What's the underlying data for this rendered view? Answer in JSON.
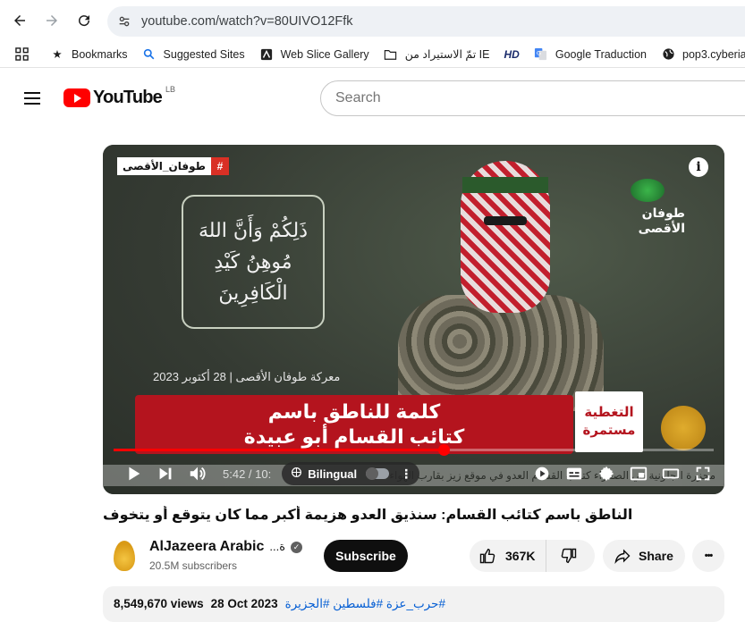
{
  "browser": {
    "url": "youtube.com/watch?v=80UIVO12Ffk"
  },
  "bookmarks": [
    {
      "label": "Bookmarks",
      "icon": "star-icon"
    },
    {
      "label": "Suggested Sites",
      "icon": "search-icon"
    },
    {
      "label": "Web Slice Gallery",
      "icon": "web-slice-icon"
    },
    {
      "label": "تمّ الاستيراد من IE",
      "icon": "folder-icon"
    },
    {
      "label": "",
      "icon": "hd-icon"
    },
    {
      "label": "Google Traduction",
      "icon": "translate-icon"
    },
    {
      "label": "pop3.cyberia.net.lb",
      "icon": "globe-icon"
    }
  ],
  "youtube": {
    "logo_text": "YouTube",
    "country_code": "LB",
    "search_placeholder": "Search"
  },
  "player": {
    "hashtag": "طوفان_الأقصى",
    "hashtag_symbol": "#",
    "verse_lines": [
      "ذَلِكُمْ وَأَنَّ اللهَ",
      "مُوهِنُ كَيْدِ",
      "الْكَافِرِينَ"
    ],
    "emblem_text": "طوفان الأقصى",
    "date_line": "معركة طوفان الأقصى | 28 أكتوبر 2023",
    "banner_lines": [
      "كلمة للناطق باسم",
      "كتائب القسام أبو عبيدة"
    ],
    "coverage_lines": [
      "التغطية",
      "مستمرة"
    ],
    "ticker_text": "مجزرة الجلونية في الصفراء كتائب القسام العدو في موقع زيز بقارب الهواء",
    "time_display": "5:42 / 10:",
    "progress_fraction": 0.55,
    "bilingual_label": "Bilingual",
    "info_symbol": "i"
  },
  "video": {
    "title": "الناطق باسم كتائب القسام: سنذيق العدو هزيمة أكبر مما كان يتوقع أو يتخوف",
    "channel_name": "AlJazeera Arabic",
    "channel_name_ar": "...ة",
    "subscribers": "20.5M subscribers",
    "subscribe_label": "Subscribe",
    "likes": "367K",
    "share_label": "Share",
    "more_symbol": "•••",
    "views": "8,549,670 views",
    "date": "28 Oct 2023",
    "tags": "#حرب_عزة #فلسطين #الجزيرة"
  },
  "colors": {
    "youtube_red": "#ff0000",
    "banner_red": "#b4141e",
    "link_blue": "#065fd4"
  }
}
